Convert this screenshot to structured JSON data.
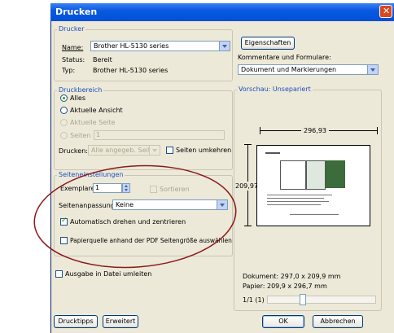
{
  "window": {
    "title": "Drucken",
    "close_glyph": "✕"
  },
  "printer": {
    "group_label": "Drucker",
    "name_label": "Name:",
    "name_value": "Brother HL-5130 series",
    "status_label": "Status:",
    "status_value": "Bereit",
    "type_label": "Typ:",
    "type_value": "Brother HL-5130 series",
    "properties_button": "Eigenschaften",
    "comments_label": "Kommentare und Formulare:",
    "comments_value": "Dokument und Markierungen"
  },
  "range": {
    "group_label": "Druckbereich",
    "all": "Alles",
    "current_view": "Aktuelle Ansicht",
    "current_page": "Aktuelle Seite",
    "pages_label": "Seiten",
    "pages_value": "1",
    "print_label": "Drucken:",
    "print_value": "Alle angegeb. Seiten",
    "reverse_pages": "Seiten umkehren"
  },
  "page_settings": {
    "group_label": "Seiteneinstellungen",
    "copies_label": "Exemplare:",
    "copies_value": "1",
    "collate": "Sortieren",
    "scaling_label": "Seitenanpassung:",
    "scaling_value": "Keine",
    "auto_rotate": "Automatisch drehen und zentrieren",
    "paper_source": "Papierquelle anhand der PDF Seitengröße auswählen"
  },
  "print_to_file": "Ausgabe in Datei umleiten",
  "preview": {
    "group_label": "Vorschau: Unsepariert",
    "width_value": "296,93",
    "height_value": "209,97",
    "document_size": "Dokument: 297,0 x 209,9 mm",
    "paper_size": "Papier: 209,9 x 296,7 mm",
    "page_counter": "1/1 (1)"
  },
  "buttons": {
    "tips": "Drucktipps",
    "advanced": "Erweitert",
    "ok": "OK",
    "cancel": "Abbrechen"
  },
  "colors": {
    "titlebar": "#0a5ae0",
    "dialog_bg": "#ece9d8",
    "group_label": "#1c4fbf",
    "annotation_ellipse": "#8b1a1a"
  },
  "icons": {
    "close": "close-icon",
    "dropdown": "chevron-down-icon",
    "spin": "spin-arrows-icon",
    "dimension_arrows": "dimension-arrow-icon"
  }
}
